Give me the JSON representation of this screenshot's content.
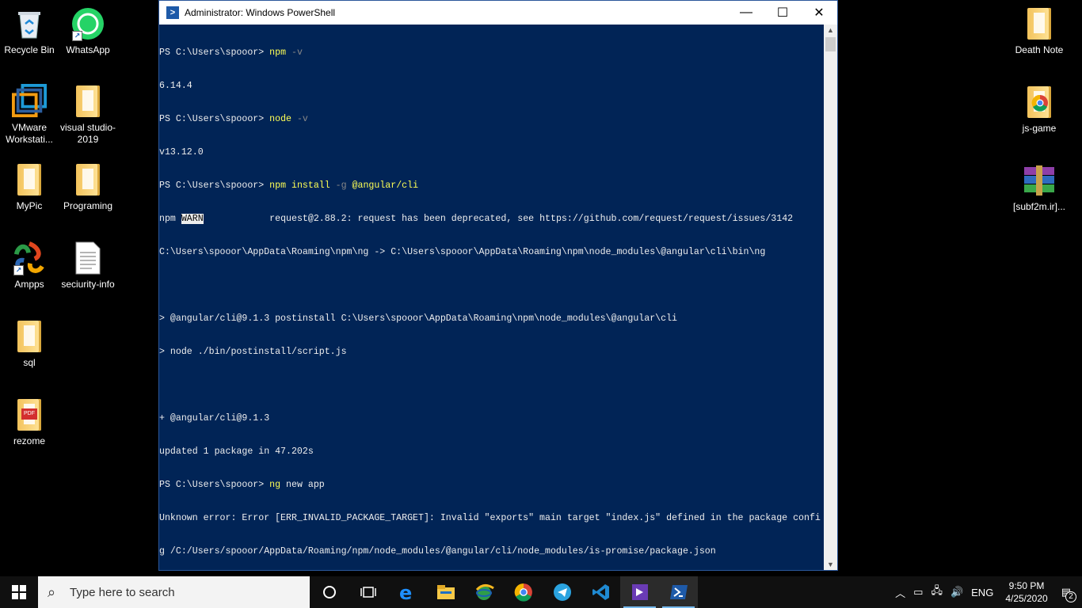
{
  "desktop": {
    "left_icons": [
      {
        "label": "Recycle Bin",
        "icon": "recycle-bin-icon"
      },
      {
        "label": "WhatsApp",
        "icon": "whatsapp-icon"
      },
      {
        "label": "VMware Workstati...",
        "icon": "vmware-icon"
      },
      {
        "label": "visual studio-2019",
        "icon": "folder-icon"
      },
      {
        "label": "MyPic",
        "icon": "folder-icon"
      },
      {
        "label": "Programing",
        "icon": "folder-icon"
      },
      {
        "label": "Ampps",
        "icon": "ampps-icon"
      },
      {
        "label": "seciurity-info",
        "icon": "text-file-icon"
      },
      {
        "label": "sql",
        "icon": "folder-icon"
      },
      {
        "label": "rezome",
        "icon": "pdf-folder-icon"
      }
    ],
    "right_icons": [
      {
        "label": "Death Note",
        "icon": "folder-icon"
      },
      {
        "label": "js-game",
        "icon": "chrome-folder-icon"
      },
      {
        "label": "[subf2m.ir]...",
        "icon": "winrar-archive-icon"
      }
    ]
  },
  "window": {
    "title": "Administrator: Windows PowerShell",
    "controls": {
      "minimize": "—",
      "maximize": "☐",
      "close": "✕"
    }
  },
  "console": {
    "prompt": "PS C:\\Users\\spooor> ",
    "lines": {
      "l1_cmd": "npm",
      "l1_flag": " -v",
      "l2": "6.14.4",
      "l3_cmd": "node",
      "l3_flag": " -v",
      "l4": "v13.12.0",
      "l5_cmd": "npm",
      "l5_rest1": " install ",
      "l5_flag": "-g",
      "l5_rest2": " @angular/cli",
      "l6_pre": "npm ",
      "l6_warn": "WARN",
      "l6_rest": "            request@2.88.2: request has been deprecated, see https://github.com/request/request/issues/3142",
      "l7": "C:\\Users\\spooor\\AppData\\Roaming\\npm\\ng -> C:\\Users\\spooor\\AppData\\Roaming\\npm\\node_modules\\@angular\\cli\\bin\\ng",
      "l8": "",
      "l9": "> @angular/cli@9.1.3 postinstall C:\\Users\\spooor\\AppData\\Roaming\\npm\\node_modules\\@angular\\cli",
      "l10": "> node ./bin/postinstall/script.js",
      "l11": "",
      "l12": "+ @angular/cli@9.1.3",
      "l13": "updated 1 package in 47.202s",
      "l14_cmd": "ng",
      "l14_rest": " new app",
      "l15": "Unknown error: Error [ERR_INVALID_PACKAGE_TARGET]: Invalid \"exports\" main target \"index.js\" defined in the package confi",
      "l16": "g /C:/Users/spooor/AppData/Roaming/npm/node_modules/@angular/cli/node_modules/is-promise/package.json"
    }
  },
  "taskbar": {
    "search_placeholder": "Type here to search",
    "apps": [
      "cortana-icon",
      "task-view-icon",
      "edge-icon",
      "file-explorer-icon",
      "network-globe-icon",
      "chrome-icon",
      "telegram-icon",
      "vscode-icon",
      "visual-studio-icon",
      "powershell-icon"
    ],
    "tray": {
      "language": "ENG",
      "time": "9:50 PM",
      "date": "4/25/2020",
      "notifications": "2"
    }
  }
}
